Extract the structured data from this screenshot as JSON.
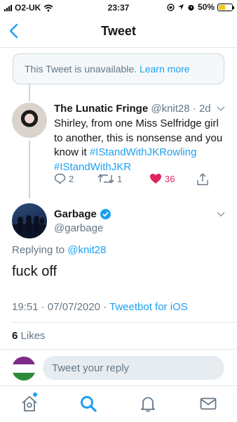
{
  "status_bar": {
    "carrier": "O2-UK",
    "time": "23:37",
    "battery": "50%",
    "battery_level": 0.5
  },
  "nav": {
    "title": "Tweet"
  },
  "unavailable": {
    "message": "This Tweet is unavailable.",
    "learn_more": "Learn more"
  },
  "parent_tweet": {
    "name": "The Lunatic Fringe",
    "handle": "@knit28",
    "age": "2d",
    "text": "Shirley, from one Miss Selfridge girl to another, this is nonsense and you know it",
    "hashtags": [
      "#IStandWithJKRowling",
      "#IStandWithJKR"
    ],
    "replies": "2",
    "retweets": "1",
    "likes": "36"
  },
  "main_tweet": {
    "name": "Garbage",
    "handle": "@garbage",
    "replying_label": "Replying to",
    "replying_to": "@knit28",
    "text": "fuck off",
    "timestamp": "19:51 · 07/07/2020 · ",
    "client": "Tweetbot for iOS",
    "like_count": "6",
    "like_label": "Likes"
  },
  "reply_bar": {
    "placeholder": "Tweet your reply"
  },
  "colors": {
    "accent": "#1da1f2",
    "like": "#e0245e",
    "secondary_text": "#657786"
  },
  "icons": {
    "back": "chevron-left-icon",
    "reply": "reply-icon",
    "retweet": "retweet-icon",
    "like": "heart-icon",
    "share": "share-icon",
    "home": "home-icon",
    "search": "search-icon",
    "notifications": "bell-icon",
    "messages": "mail-icon"
  }
}
